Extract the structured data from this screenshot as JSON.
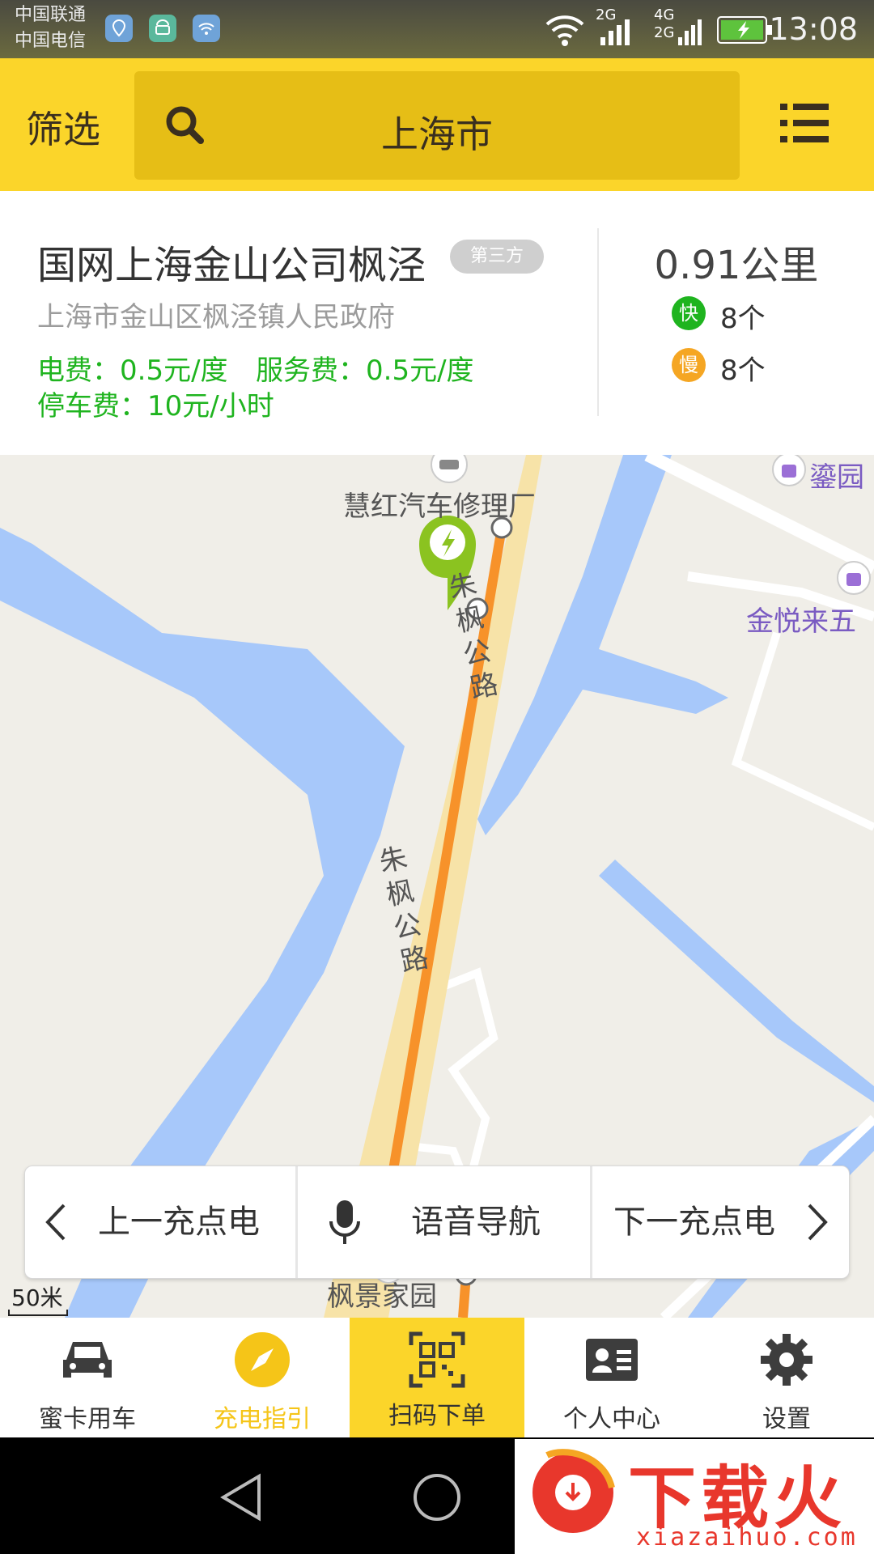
{
  "status_bar": {
    "carrier_1": "中国联通",
    "carrier_2": "中国电信",
    "net_2g": "2G",
    "net_4g": "4G",
    "net_2g_b": "2G",
    "time": "13:08",
    "icons": [
      "location-icon",
      "android-icon",
      "wifi-hotspot-icon",
      "wifi-icon",
      "signal-icon",
      "battery-charging-icon"
    ]
  },
  "header": {
    "filter_label": "筛选",
    "search_text": "上海市",
    "colors": {
      "bar": "#fbd52a",
      "search_box": "#e6be16"
    }
  },
  "station": {
    "name": "国网上海金山公司枫泾",
    "badge": "第三方",
    "address": "上海市金山区枫泾镇人民政府",
    "electricity_fee": "电费：0.5元/度",
    "service_fee": "服务费：0.5元/度",
    "parking_fee": "停车费：10元/小时",
    "distance": "0.91公里",
    "fast_label": "快",
    "fast_count": "8个",
    "slow_label": "慢",
    "slow_count": "8个",
    "colors": {
      "fee": "#1fb41f",
      "fast": "#1fb41f",
      "slow": "#f5a623"
    }
  },
  "map": {
    "labels": {
      "repair_shop": "慧红汽车修理厂",
      "road_1": "朱枫公路",
      "road_2": "朱枫公路",
      "community": "枫景家园",
      "poi_1": "鎏园",
      "poi_2": "金悦来五"
    },
    "scale": "50米",
    "colors": {
      "water": "#a7c8fa",
      "road": "#f7e3a8",
      "route": "#f7922a",
      "land": "#f0eee8"
    }
  },
  "actions": {
    "prev": "上一充点电",
    "voice": "语音导航",
    "next": "下一充点电"
  },
  "nav": {
    "items": [
      {
        "label": "蜜卡用车",
        "icon": "car-icon"
      },
      {
        "label": "充电指引",
        "icon": "compass-icon",
        "active": true
      },
      {
        "label": "扫码下单",
        "icon": "qr-scan-icon",
        "highlight": true
      },
      {
        "label": "个人中心",
        "icon": "id-card-icon"
      },
      {
        "label": "设置",
        "icon": "gear-icon"
      }
    ],
    "colors": {
      "active": "#f5c518",
      "highlight_bg": "#fbd52a"
    }
  },
  "watermark": {
    "title": "下载火",
    "url": "xiazaihuo.com"
  }
}
